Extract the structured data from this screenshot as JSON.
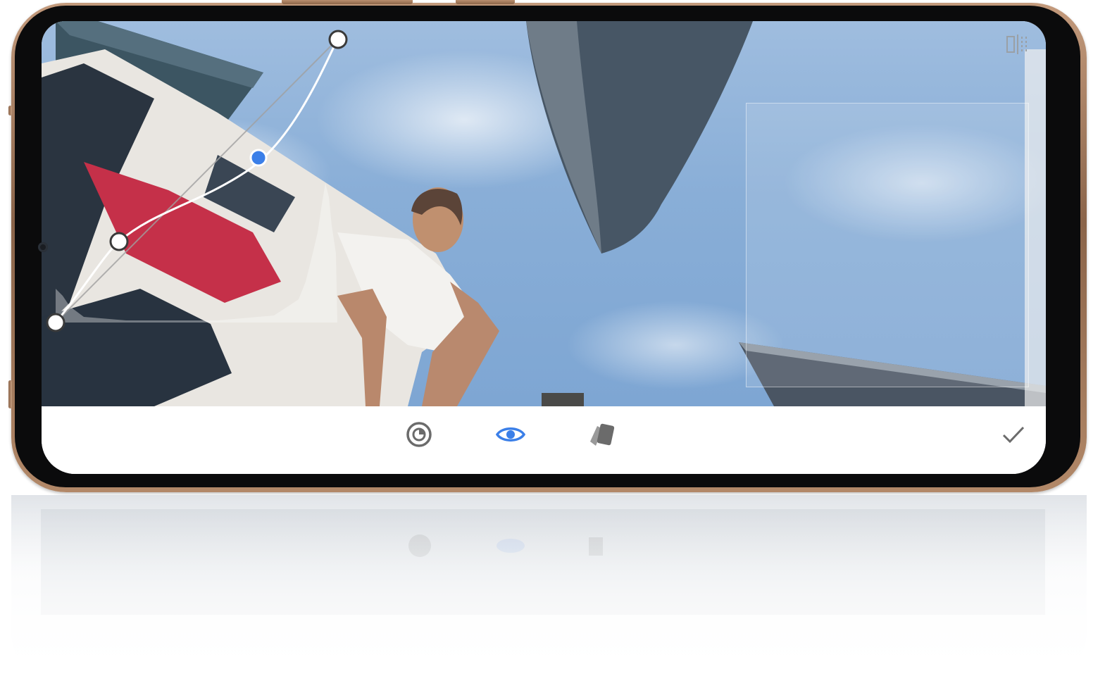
{
  "toolbar": {
    "tools": [
      {
        "icon": "tone-dial-icon",
        "active": false
      },
      {
        "icon": "eye-icon",
        "active": true
      },
      {
        "icon": "color-swatch-icon",
        "active": false
      }
    ],
    "confirm_icon": "checkmark-icon"
  },
  "overlay": {
    "compare_icon": "compare-split-icon",
    "curve_points_icon": "curve-control-point-icon"
  },
  "colors": {
    "accent": "#3b7fe8",
    "inactive_icon": "#6b6b6b",
    "frame": "#b48a6b"
  }
}
